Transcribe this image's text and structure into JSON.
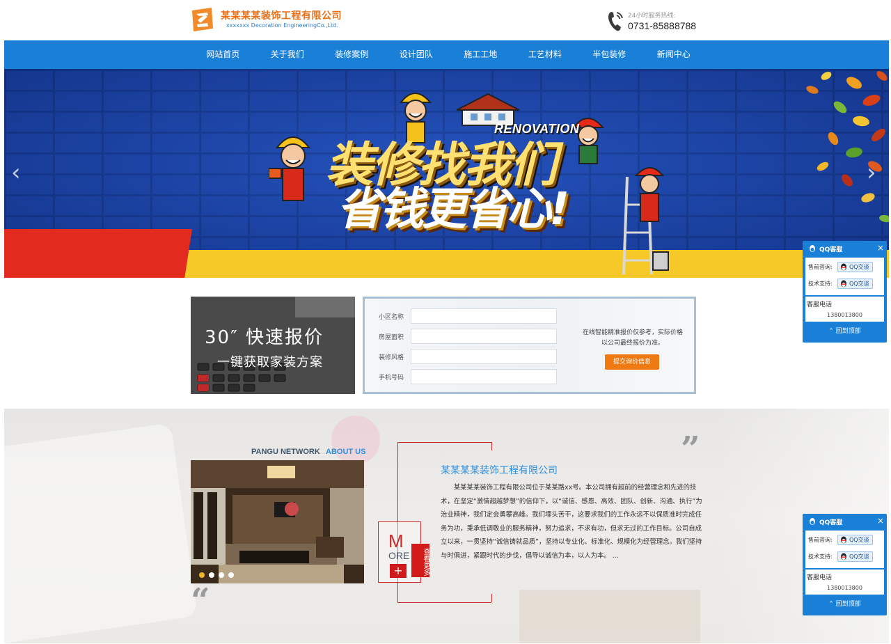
{
  "header": {
    "company_name": "某某某某装饰工程有限公司",
    "company_name_en": "xxxxxxx Decoration EngineeringCo.,Ltd.",
    "hotline_label": "24小时服务热线:",
    "hotline_number": "0731-85888788"
  },
  "nav": {
    "items": [
      "网站首页",
      "关于我们",
      "装修案例",
      "设计团队",
      "施工工地",
      "工艺材料",
      "半包装修",
      "新闻中心"
    ]
  },
  "banner": {
    "slogan_en": "RENOVATION",
    "slogan_line1": "装修找我们",
    "slogan_line2": "省钱更省心!",
    "prev_arrow": "‹",
    "next_arrow": "›"
  },
  "quote": {
    "promo_title": "30″ 快速报价",
    "promo_subtitle": "一键获取家装方案",
    "fields": [
      "小区名称",
      "房屋面积",
      "装修风格",
      "手机号码"
    ],
    "note": "在线智能精准报价仅参考，实际价格以公司最终报价为准。",
    "submit_label": "提交询价信息"
  },
  "about": {
    "tag1": "PANGU NETWORK",
    "tag2": "ABOUT US",
    "title": "某某某某装饰工程有限公司",
    "text": "某某某某装饰工程有限公司位于某某路xx号。本公司拥有超前的经营理念和先进的技术，在坚定“激情超越梦想”的信仰下，以“诚信、感恩、高效、团队、创新、沟通、执行”为治业精神，我们定会勇攀高峰。我们埋头苦干，这要求我们的工作永远不以保质准时完成任务为功，秉承低调敬业的服务精神，努力追求，不求有功，但求无过的工作目标。公司自成立以来，一贯坚持“诚信铸就品质”，坚持以专业化、标准化、规模化为经营理念。我们坚持与时俱进，紧跟时代的步伐，倡导以诚信为本，以人为本。 ...",
    "more_m": "M",
    "more_ore": "ORE",
    "more_plus": "+",
    "more_vertical": "查看更多",
    "open_quote": "“",
    "close_quote": "”"
  },
  "qq_widget": {
    "title": "QQ客服",
    "close": "×",
    "presales_label": "售前咨询:",
    "tech_label": "技术支持:",
    "chat_label": "QQ交谈",
    "phone_label": "客服电话",
    "phone_number": "1380013800",
    "back_top": "回到顶部"
  },
  "colors": {
    "brand_blue": "#1a7fd6",
    "brand_orange": "#e8701a",
    "accent_red": "#cc2a2a"
  }
}
